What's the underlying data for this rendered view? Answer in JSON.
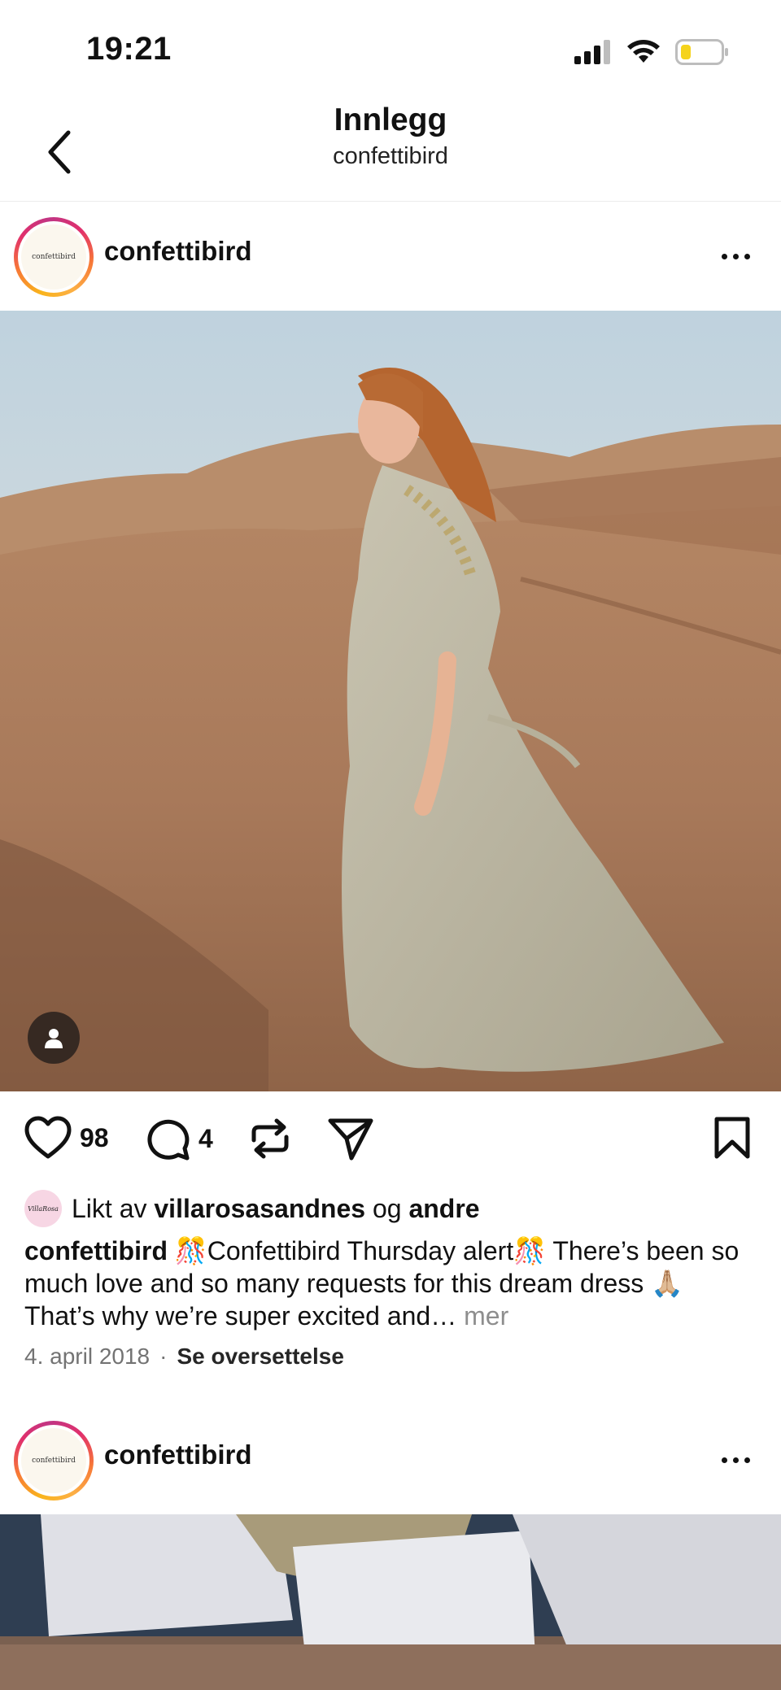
{
  "status_bar": {
    "time": "19:21",
    "icons": [
      "signal-icon",
      "wifi-icon",
      "battery-icon"
    ]
  },
  "header": {
    "title": "Innlegg",
    "subtitle": "confettibird",
    "back_icon": "chevron-left-icon"
  },
  "posts": [
    {
      "username": "confettibird",
      "avatar_text": "confettibird",
      "likes": "98",
      "comments": "4",
      "liked_by_prefix": "Likt av",
      "liked_by_user": "villarosasandnes",
      "liked_by_joiner": "og",
      "liked_by_others": "andre",
      "liker_avatar_text": "VillaRosa",
      "caption_user": "confettibird",
      "caption_text": " 🎊Confettibird Thursday alert🎊 There’s been so much love and so many requests for this dream dress 🙏🏼 That’s why we’re super excited and…",
      "caption_more": "mer",
      "date": "4. april 2018",
      "separator": "·",
      "translate": "Se oversettelse"
    },
    {
      "username": "confettibird",
      "avatar_text": "confettibird"
    }
  ],
  "colors": {
    "text": "#111111",
    "muted": "#737373",
    "story_ring": [
      "#f9b41c",
      "#e1306c",
      "#c13584"
    ]
  }
}
